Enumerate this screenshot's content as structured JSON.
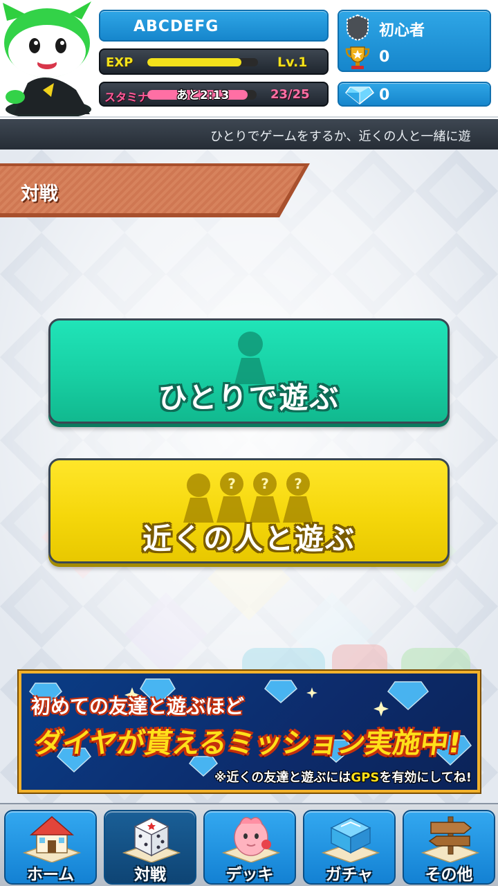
{
  "header": {
    "player_name": "ABCDEFG",
    "exp_label": "EXP",
    "exp_fraction": 0.85,
    "level": "Lv.1",
    "stamina_label": "スタミナ",
    "stamina_timer": "あと2:13",
    "stamina_count": "23/25",
    "stamina_fraction": 0.92,
    "rank_title": "初心者",
    "trophy_count": "0",
    "diamond_count": "0"
  },
  "ticker": {
    "text": "ひとりでゲームをするか、近くの人と一緒に遊"
  },
  "section": {
    "title": "対戦"
  },
  "buttons": {
    "solo": "ひとりで遊ぶ",
    "nearby": "近くの人と遊ぶ"
  },
  "banner": {
    "line1": "初めての友達と遊ぶほど",
    "line2": "ダイヤが貰えるミッション実施中!",
    "note_prefix": "※近くの友達と遊ぶには",
    "note_gps": "GPS",
    "note_suffix": "を有効にしてね!"
  },
  "nav": {
    "items": [
      {
        "label": "ホーム",
        "icon": "house-icon"
      },
      {
        "label": "対戦",
        "icon": "dice-icon"
      },
      {
        "label": "デッキ",
        "icon": "character-icon"
      },
      {
        "label": "ガチャ",
        "icon": "crystal-icon"
      },
      {
        "label": "その他",
        "icon": "signpost-icon"
      }
    ],
    "active_index": 1
  },
  "colors": {
    "pill_blue": "#1686cc",
    "solo_green": "#18cfa3",
    "nearby_yellow": "#f5d70b",
    "banner_gold": "#f2b22c"
  }
}
